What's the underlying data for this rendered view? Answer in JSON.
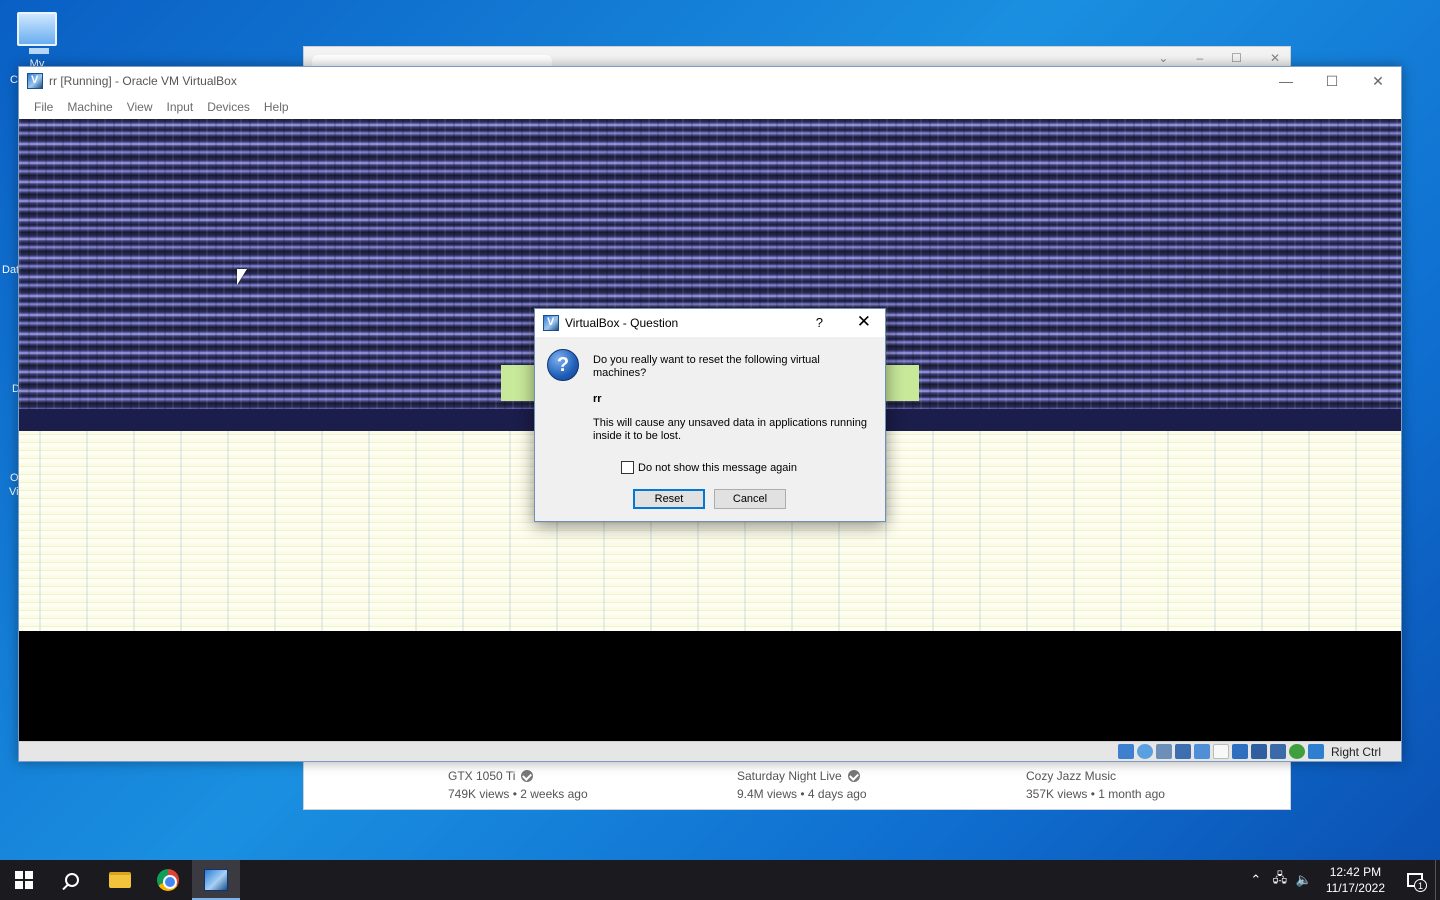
{
  "desktop": {
    "icons": [
      {
        "label": "My"
      }
    ],
    "stubs": [
      "C",
      "Dat",
      "D",
      "O",
      "Vi"
    ]
  },
  "browser_bg": {
    "videos": [
      {
        "channel": "GTX 1050 Ti",
        "stats": "749K views • 2 weeks ago",
        "verified": true
      },
      {
        "channel": "Saturday Night Live",
        "stats": "9.4M views • 4 days ago",
        "verified": true
      },
      {
        "channel": "Cozy Jazz Music",
        "stats": "357K views • 1 month ago",
        "verified": false
      }
    ]
  },
  "vbox": {
    "title": "rr [Running] - Oracle VM VirtualBox",
    "menu": [
      "File",
      "Machine",
      "View",
      "Input",
      "Devices",
      "Help"
    ],
    "status_key": "Right Ctrl",
    "status_icons": [
      {
        "name": "hard-disk-icon",
        "color": "#3f7fcf"
      },
      {
        "name": "optical-drive-icon",
        "color": "#5aa0e0"
      },
      {
        "name": "audio-icon",
        "color": "#6c8fb8"
      },
      {
        "name": "network-icon",
        "color": "#3d6fb0"
      },
      {
        "name": "usb-icon",
        "color": "#4f8fd8"
      },
      {
        "name": "shared-folders-icon",
        "color": "#d8d8d8"
      },
      {
        "name": "display-icon",
        "color": "#2f6fc0"
      },
      {
        "name": "video-capture-icon",
        "color": "#2f5f9f"
      },
      {
        "name": "vt-x-icon",
        "color": "#3a6aa8"
      },
      {
        "name": "guest-additions-icon",
        "color": "#3f9f3f"
      },
      {
        "name": "mouse-integration-icon",
        "color": "#2f7fd0"
      }
    ]
  },
  "dialog": {
    "title": "VirtualBox - Question",
    "help_label": "?",
    "close_label": "✕",
    "message": "Do you really want to reset the following virtual machines?",
    "vm_name": "rr",
    "warning": "This will cause any unsaved data in applications running inside it to be lost.",
    "checkbox_label": "Do not show this message again",
    "checkbox_checked": false,
    "reset_label": "Reset",
    "cancel_label": "Cancel"
  },
  "taskbar": {
    "time": "12:42 PM",
    "date": "11/17/2022",
    "notification_count": "1"
  },
  "colors": {
    "accent": "#0078d7",
    "taskbar": "#1b1b1f"
  }
}
